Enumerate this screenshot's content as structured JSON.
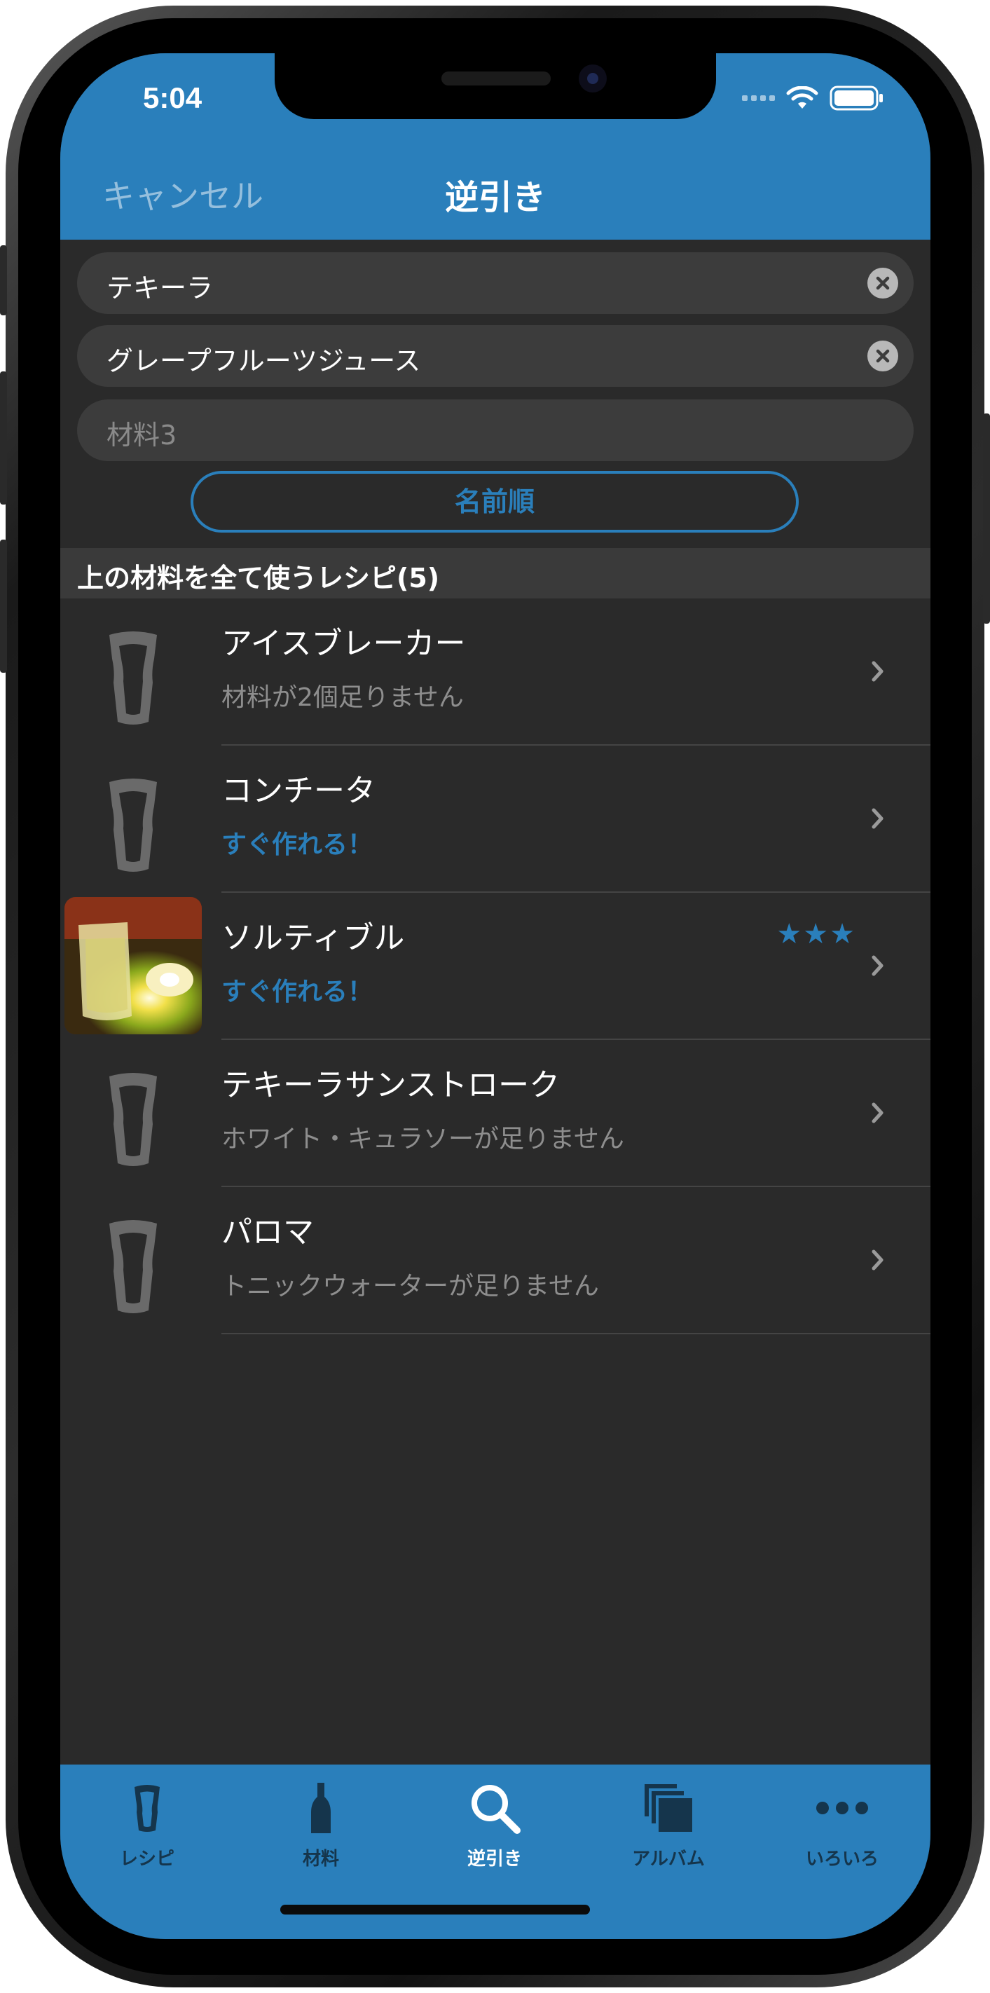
{
  "status": {
    "time": "5:04"
  },
  "nav": {
    "cancel": "キャンセル",
    "title": "逆引き"
  },
  "inputs": [
    {
      "value": "テキーラ",
      "placeholder": ""
    },
    {
      "value": "グレープフルーツジュース",
      "placeholder": ""
    },
    {
      "value": "",
      "placeholder": "材料3"
    }
  ],
  "sort_button": "名前順",
  "section": {
    "title": "上の材料を全て使うレシピ(5)"
  },
  "recipes": [
    {
      "name": "アイスブレーカー",
      "status": "材料が2個足りません",
      "can_make": false,
      "stars": "",
      "thumb": "glass-icon"
    },
    {
      "name": "コンチータ",
      "status": "すぐ作れる！",
      "can_make": true,
      "stars": "",
      "thumb": "glass-icon"
    },
    {
      "name": "ソルティブル",
      "status": "すぐ作れる！",
      "can_make": true,
      "stars": "★★★",
      "thumb": "photo"
    },
    {
      "name": "テキーラサンストローク",
      "status": "ホワイト・キュラソーが足りません",
      "can_make": false,
      "stars": "",
      "thumb": "glass-icon"
    },
    {
      "name": "パロマ",
      "status": "トニックウォーターが足りません",
      "can_make": false,
      "stars": "",
      "thumb": "glass-icon"
    }
  ],
  "tabs": [
    {
      "label": "レシピ",
      "icon": "glass-icon",
      "active": false
    },
    {
      "label": "材料",
      "icon": "bottle-icon",
      "active": false
    },
    {
      "label": "逆引き",
      "icon": "search-icon",
      "active": true
    },
    {
      "label": "アルバム",
      "icon": "album-icon",
      "active": false
    },
    {
      "label": "いろいろ",
      "icon": "more-icon",
      "active": false
    }
  ],
  "colors": {
    "accent": "#2a7fbb",
    "background": "#2a2a2a",
    "inactive_tab": "#15354c"
  }
}
